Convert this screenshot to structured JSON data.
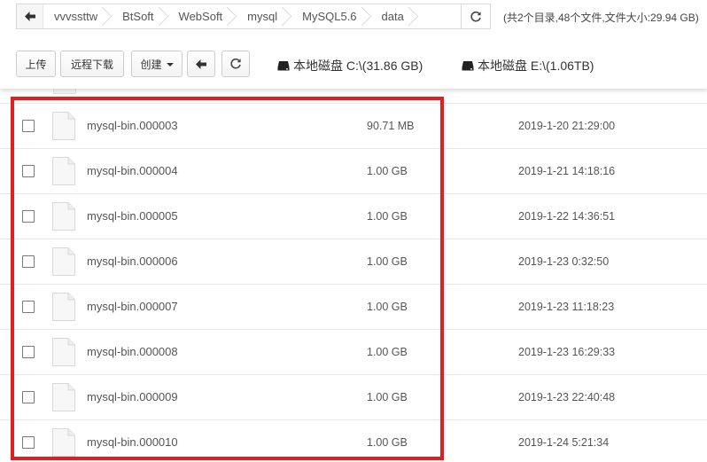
{
  "path": {
    "crumbs": [
      "vvvssttw",
      "BtSoft",
      "WebSoft",
      "mysql",
      "MySQL5.6",
      "data"
    ],
    "summary": "(共2个目录,48个文件,文件大小:29.94 GB)"
  },
  "toolbar": {
    "upload_label": "上传",
    "remote_download_label": "远程下载",
    "create_label": "创建",
    "disks": [
      {
        "label": "本地磁盘 C:\\(31.86 GB)"
      },
      {
        "label": "本地磁盘 E:\\(1.06TB)"
      }
    ]
  },
  "files": [
    {
      "name": "mysql-bin.000003",
      "size": "90.71 MB",
      "mtime": "2019-1-20  21:29:00"
    },
    {
      "name": "mysql-bin.000004",
      "size": "1.00 GB",
      "mtime": "2019-1-21  14:18:16"
    },
    {
      "name": "mysql-bin.000005",
      "size": "1.00 GB",
      "mtime": "2019-1-22  14:36:51"
    },
    {
      "name": "mysql-bin.000006",
      "size": "1.00 GB",
      "mtime": "2019-1-23  0:32:50"
    },
    {
      "name": "mysql-bin.000007",
      "size": "1.00 GB",
      "mtime": "2019-1-23  11:18:23"
    },
    {
      "name": "mysql-bin.000008",
      "size": "1.00 GB",
      "mtime": "2019-1-23  16:29:33"
    },
    {
      "name": "mysql-bin.000009",
      "size": "1.00 GB",
      "mtime": "2019-1-23  22:40:48"
    },
    {
      "name": "mysql-bin.000010",
      "size": "1.00 GB",
      "mtime": "2019-1-24  5:21:34"
    }
  ],
  "icons": {
    "back": "arrow-left-icon",
    "refresh": "refresh-icon",
    "drive": "hard-drive-icon",
    "file": "file-icon",
    "caret": "caret-down-icon"
  },
  "colors": {
    "highlight": "#e02020",
    "border": "#d9d9d9"
  }
}
